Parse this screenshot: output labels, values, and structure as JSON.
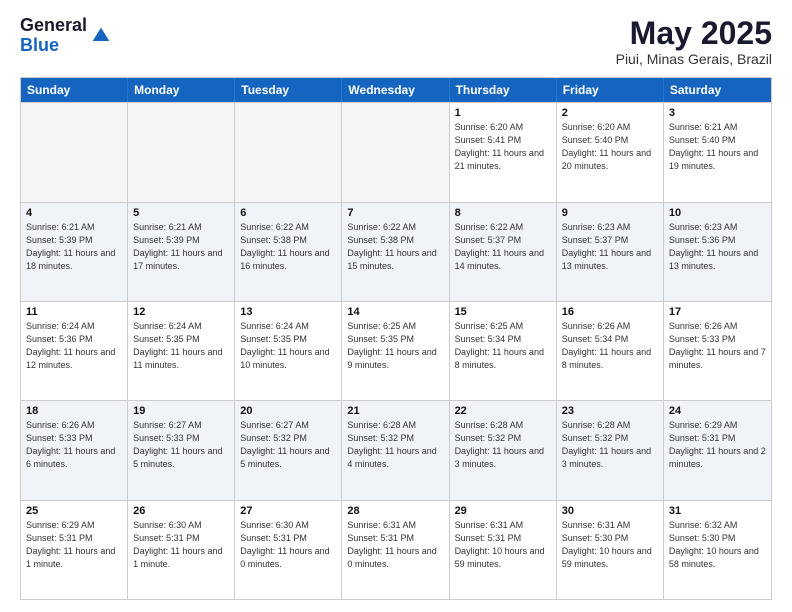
{
  "logo": {
    "general": "General",
    "blue": "Blue"
  },
  "title": "May 2025",
  "location": "Piui, Minas Gerais, Brazil",
  "weekdays": [
    "Sunday",
    "Monday",
    "Tuesday",
    "Wednesday",
    "Thursday",
    "Friday",
    "Saturday"
  ],
  "rows": [
    [
      {
        "day": "",
        "detail": "",
        "empty": true
      },
      {
        "day": "",
        "detail": "",
        "empty": true
      },
      {
        "day": "",
        "detail": "",
        "empty": true
      },
      {
        "day": "",
        "detail": "",
        "empty": true
      },
      {
        "day": "1",
        "detail": "Sunrise: 6:20 AM\nSunset: 5:41 PM\nDaylight: 11 hours\nand 21 minutes."
      },
      {
        "day": "2",
        "detail": "Sunrise: 6:20 AM\nSunset: 5:40 PM\nDaylight: 11 hours\nand 20 minutes."
      },
      {
        "day": "3",
        "detail": "Sunrise: 6:21 AM\nSunset: 5:40 PM\nDaylight: 11 hours\nand 19 minutes."
      }
    ],
    [
      {
        "day": "4",
        "detail": "Sunrise: 6:21 AM\nSunset: 5:39 PM\nDaylight: 11 hours\nand 18 minutes."
      },
      {
        "day": "5",
        "detail": "Sunrise: 6:21 AM\nSunset: 5:39 PM\nDaylight: 11 hours\nand 17 minutes."
      },
      {
        "day": "6",
        "detail": "Sunrise: 6:22 AM\nSunset: 5:38 PM\nDaylight: 11 hours\nand 16 minutes."
      },
      {
        "day": "7",
        "detail": "Sunrise: 6:22 AM\nSunset: 5:38 PM\nDaylight: 11 hours\nand 15 minutes."
      },
      {
        "day": "8",
        "detail": "Sunrise: 6:22 AM\nSunset: 5:37 PM\nDaylight: 11 hours\nand 14 minutes."
      },
      {
        "day": "9",
        "detail": "Sunrise: 6:23 AM\nSunset: 5:37 PM\nDaylight: 11 hours\nand 13 minutes."
      },
      {
        "day": "10",
        "detail": "Sunrise: 6:23 AM\nSunset: 5:36 PM\nDaylight: 11 hours\nand 13 minutes."
      }
    ],
    [
      {
        "day": "11",
        "detail": "Sunrise: 6:24 AM\nSunset: 5:36 PM\nDaylight: 11 hours\nand 12 minutes."
      },
      {
        "day": "12",
        "detail": "Sunrise: 6:24 AM\nSunset: 5:35 PM\nDaylight: 11 hours\nand 11 minutes."
      },
      {
        "day": "13",
        "detail": "Sunrise: 6:24 AM\nSunset: 5:35 PM\nDaylight: 11 hours\nand 10 minutes."
      },
      {
        "day": "14",
        "detail": "Sunrise: 6:25 AM\nSunset: 5:35 PM\nDaylight: 11 hours\nand 9 minutes."
      },
      {
        "day": "15",
        "detail": "Sunrise: 6:25 AM\nSunset: 5:34 PM\nDaylight: 11 hours\nand 8 minutes."
      },
      {
        "day": "16",
        "detail": "Sunrise: 6:26 AM\nSunset: 5:34 PM\nDaylight: 11 hours\nand 8 minutes."
      },
      {
        "day": "17",
        "detail": "Sunrise: 6:26 AM\nSunset: 5:33 PM\nDaylight: 11 hours\nand 7 minutes."
      }
    ],
    [
      {
        "day": "18",
        "detail": "Sunrise: 6:26 AM\nSunset: 5:33 PM\nDaylight: 11 hours\nand 6 minutes."
      },
      {
        "day": "19",
        "detail": "Sunrise: 6:27 AM\nSunset: 5:33 PM\nDaylight: 11 hours\nand 5 minutes."
      },
      {
        "day": "20",
        "detail": "Sunrise: 6:27 AM\nSunset: 5:32 PM\nDaylight: 11 hours\nand 5 minutes."
      },
      {
        "day": "21",
        "detail": "Sunrise: 6:28 AM\nSunset: 5:32 PM\nDaylight: 11 hours\nand 4 minutes."
      },
      {
        "day": "22",
        "detail": "Sunrise: 6:28 AM\nSunset: 5:32 PM\nDaylight: 11 hours\nand 3 minutes."
      },
      {
        "day": "23",
        "detail": "Sunrise: 6:28 AM\nSunset: 5:32 PM\nDaylight: 11 hours\nand 3 minutes."
      },
      {
        "day": "24",
        "detail": "Sunrise: 6:29 AM\nSunset: 5:31 PM\nDaylight: 11 hours\nand 2 minutes."
      }
    ],
    [
      {
        "day": "25",
        "detail": "Sunrise: 6:29 AM\nSunset: 5:31 PM\nDaylight: 11 hours\nand 1 minute."
      },
      {
        "day": "26",
        "detail": "Sunrise: 6:30 AM\nSunset: 5:31 PM\nDaylight: 11 hours\nand 1 minute."
      },
      {
        "day": "27",
        "detail": "Sunrise: 6:30 AM\nSunset: 5:31 PM\nDaylight: 11 hours\nand 0 minutes."
      },
      {
        "day": "28",
        "detail": "Sunrise: 6:31 AM\nSunset: 5:31 PM\nDaylight: 11 hours\nand 0 minutes."
      },
      {
        "day": "29",
        "detail": "Sunrise: 6:31 AM\nSunset: 5:31 PM\nDaylight: 10 hours\nand 59 minutes."
      },
      {
        "day": "30",
        "detail": "Sunrise: 6:31 AM\nSunset: 5:30 PM\nDaylight: 10 hours\nand 59 minutes."
      },
      {
        "day": "31",
        "detail": "Sunrise: 6:32 AM\nSunset: 5:30 PM\nDaylight: 10 hours\nand 58 minutes."
      }
    ]
  ]
}
